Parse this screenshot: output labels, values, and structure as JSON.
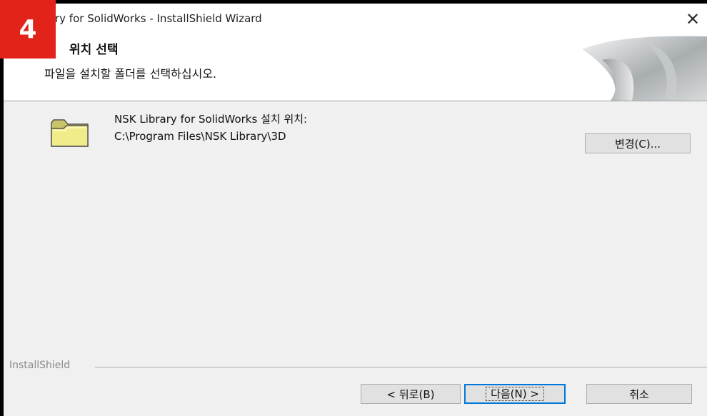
{
  "badge": {
    "text": "4",
    "color": "#e2231a"
  },
  "window": {
    "title": "ry for SolidWorks - InstallShield Wizard",
    "close_glyph": "✕"
  },
  "header": {
    "title": "위치 선택",
    "subtitle": "파일을 설치할 폴더를 선택하십시오."
  },
  "main": {
    "folder_icon": "folder-icon",
    "install_label": "NSK Library for SolidWorks 설치 위치:",
    "install_path": "C:\\Program Files\\NSK Library\\3D",
    "change_button": "변경(C)..."
  },
  "footer": {
    "brand": "InstallShield",
    "back_button": "< 뒤로(B)",
    "next_button": "다음(N) >",
    "cancel_button": "취소"
  },
  "colors": {
    "focus_border": "#0078d7",
    "folder_fill": "#f1ec8a"
  }
}
